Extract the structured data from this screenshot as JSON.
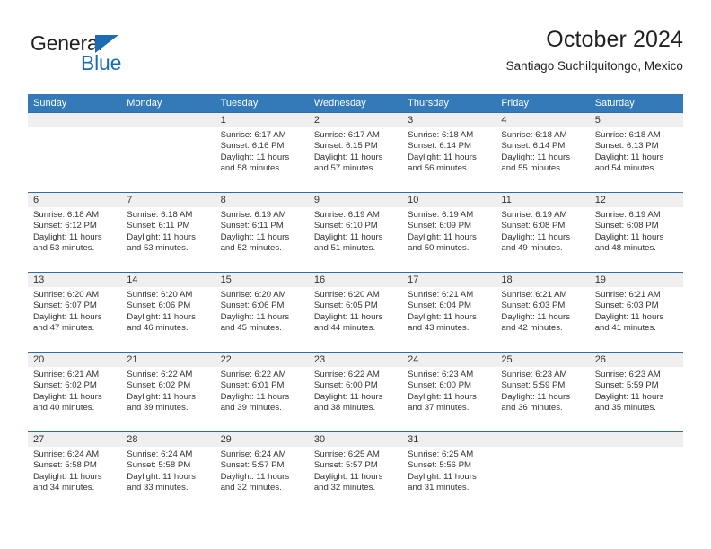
{
  "brand": {
    "name_top": "General",
    "name_bottom": "Blue",
    "accent_color": "#1b6cb5"
  },
  "header": {
    "title": "October 2024",
    "subtitle": "Santiago Suchilquitongo, Mexico"
  },
  "calendar": {
    "header_bg": "#3479b8",
    "number_band_bg": "#efefef",
    "weekday_headers": [
      "Sunday",
      "Monday",
      "Tuesday",
      "Wednesday",
      "Thursday",
      "Friday",
      "Saturday"
    ],
    "weeks": [
      [
        {
          "day": "",
          "sunrise": "",
          "sunset": "",
          "daylight_1": "",
          "daylight_2": ""
        },
        {
          "day": "",
          "sunrise": "",
          "sunset": "",
          "daylight_1": "",
          "daylight_2": ""
        },
        {
          "day": "1",
          "sunrise": "Sunrise: 6:17 AM",
          "sunset": "Sunset: 6:16 PM",
          "daylight_1": "Daylight: 11 hours",
          "daylight_2": "and 58 minutes."
        },
        {
          "day": "2",
          "sunrise": "Sunrise: 6:17 AM",
          "sunset": "Sunset: 6:15 PM",
          "daylight_1": "Daylight: 11 hours",
          "daylight_2": "and 57 minutes."
        },
        {
          "day": "3",
          "sunrise": "Sunrise: 6:18 AM",
          "sunset": "Sunset: 6:14 PM",
          "daylight_1": "Daylight: 11 hours",
          "daylight_2": "and 56 minutes."
        },
        {
          "day": "4",
          "sunrise": "Sunrise: 6:18 AM",
          "sunset": "Sunset: 6:14 PM",
          "daylight_1": "Daylight: 11 hours",
          "daylight_2": "and 55 minutes."
        },
        {
          "day": "5",
          "sunrise": "Sunrise: 6:18 AM",
          "sunset": "Sunset: 6:13 PM",
          "daylight_1": "Daylight: 11 hours",
          "daylight_2": "and 54 minutes."
        }
      ],
      [
        {
          "day": "6",
          "sunrise": "Sunrise: 6:18 AM",
          "sunset": "Sunset: 6:12 PM",
          "daylight_1": "Daylight: 11 hours",
          "daylight_2": "and 53 minutes."
        },
        {
          "day": "7",
          "sunrise": "Sunrise: 6:18 AM",
          "sunset": "Sunset: 6:11 PM",
          "daylight_1": "Daylight: 11 hours",
          "daylight_2": "and 53 minutes."
        },
        {
          "day": "8",
          "sunrise": "Sunrise: 6:19 AM",
          "sunset": "Sunset: 6:11 PM",
          "daylight_1": "Daylight: 11 hours",
          "daylight_2": "and 52 minutes."
        },
        {
          "day": "9",
          "sunrise": "Sunrise: 6:19 AM",
          "sunset": "Sunset: 6:10 PM",
          "daylight_1": "Daylight: 11 hours",
          "daylight_2": "and 51 minutes."
        },
        {
          "day": "10",
          "sunrise": "Sunrise: 6:19 AM",
          "sunset": "Sunset: 6:09 PM",
          "daylight_1": "Daylight: 11 hours",
          "daylight_2": "and 50 minutes."
        },
        {
          "day": "11",
          "sunrise": "Sunrise: 6:19 AM",
          "sunset": "Sunset: 6:08 PM",
          "daylight_1": "Daylight: 11 hours",
          "daylight_2": "and 49 minutes."
        },
        {
          "day": "12",
          "sunrise": "Sunrise: 6:19 AM",
          "sunset": "Sunset: 6:08 PM",
          "daylight_1": "Daylight: 11 hours",
          "daylight_2": "and 48 minutes."
        }
      ],
      [
        {
          "day": "13",
          "sunrise": "Sunrise: 6:20 AM",
          "sunset": "Sunset: 6:07 PM",
          "daylight_1": "Daylight: 11 hours",
          "daylight_2": "and 47 minutes."
        },
        {
          "day": "14",
          "sunrise": "Sunrise: 6:20 AM",
          "sunset": "Sunset: 6:06 PM",
          "daylight_1": "Daylight: 11 hours",
          "daylight_2": "and 46 minutes."
        },
        {
          "day": "15",
          "sunrise": "Sunrise: 6:20 AM",
          "sunset": "Sunset: 6:06 PM",
          "daylight_1": "Daylight: 11 hours",
          "daylight_2": "and 45 minutes."
        },
        {
          "day": "16",
          "sunrise": "Sunrise: 6:20 AM",
          "sunset": "Sunset: 6:05 PM",
          "daylight_1": "Daylight: 11 hours",
          "daylight_2": "and 44 minutes."
        },
        {
          "day": "17",
          "sunrise": "Sunrise: 6:21 AM",
          "sunset": "Sunset: 6:04 PM",
          "daylight_1": "Daylight: 11 hours",
          "daylight_2": "and 43 minutes."
        },
        {
          "day": "18",
          "sunrise": "Sunrise: 6:21 AM",
          "sunset": "Sunset: 6:03 PM",
          "daylight_1": "Daylight: 11 hours",
          "daylight_2": "and 42 minutes."
        },
        {
          "day": "19",
          "sunrise": "Sunrise: 6:21 AM",
          "sunset": "Sunset: 6:03 PM",
          "daylight_1": "Daylight: 11 hours",
          "daylight_2": "and 41 minutes."
        }
      ],
      [
        {
          "day": "20",
          "sunrise": "Sunrise: 6:21 AM",
          "sunset": "Sunset: 6:02 PM",
          "daylight_1": "Daylight: 11 hours",
          "daylight_2": "and 40 minutes."
        },
        {
          "day": "21",
          "sunrise": "Sunrise: 6:22 AM",
          "sunset": "Sunset: 6:02 PM",
          "daylight_1": "Daylight: 11 hours",
          "daylight_2": "and 39 minutes."
        },
        {
          "day": "22",
          "sunrise": "Sunrise: 6:22 AM",
          "sunset": "Sunset: 6:01 PM",
          "daylight_1": "Daylight: 11 hours",
          "daylight_2": "and 39 minutes."
        },
        {
          "day": "23",
          "sunrise": "Sunrise: 6:22 AM",
          "sunset": "Sunset: 6:00 PM",
          "daylight_1": "Daylight: 11 hours",
          "daylight_2": "and 38 minutes."
        },
        {
          "day": "24",
          "sunrise": "Sunrise: 6:23 AM",
          "sunset": "Sunset: 6:00 PM",
          "daylight_1": "Daylight: 11 hours",
          "daylight_2": "and 37 minutes."
        },
        {
          "day": "25",
          "sunrise": "Sunrise: 6:23 AM",
          "sunset": "Sunset: 5:59 PM",
          "daylight_1": "Daylight: 11 hours",
          "daylight_2": "and 36 minutes."
        },
        {
          "day": "26",
          "sunrise": "Sunrise: 6:23 AM",
          "sunset": "Sunset: 5:59 PM",
          "daylight_1": "Daylight: 11 hours",
          "daylight_2": "and 35 minutes."
        }
      ],
      [
        {
          "day": "27",
          "sunrise": "Sunrise: 6:24 AM",
          "sunset": "Sunset: 5:58 PM",
          "daylight_1": "Daylight: 11 hours",
          "daylight_2": "and 34 minutes."
        },
        {
          "day": "28",
          "sunrise": "Sunrise: 6:24 AM",
          "sunset": "Sunset: 5:58 PM",
          "daylight_1": "Daylight: 11 hours",
          "daylight_2": "and 33 minutes."
        },
        {
          "day": "29",
          "sunrise": "Sunrise: 6:24 AM",
          "sunset": "Sunset: 5:57 PM",
          "daylight_1": "Daylight: 11 hours",
          "daylight_2": "and 32 minutes."
        },
        {
          "day": "30",
          "sunrise": "Sunrise: 6:25 AM",
          "sunset": "Sunset: 5:57 PM",
          "daylight_1": "Daylight: 11 hours",
          "daylight_2": "and 32 minutes."
        },
        {
          "day": "31",
          "sunrise": "Sunrise: 6:25 AM",
          "sunset": "Sunset: 5:56 PM",
          "daylight_1": "Daylight: 11 hours",
          "daylight_2": "and 31 minutes."
        },
        {
          "day": "",
          "sunrise": "",
          "sunset": "",
          "daylight_1": "",
          "daylight_2": ""
        },
        {
          "day": "",
          "sunrise": "",
          "sunset": "",
          "daylight_1": "",
          "daylight_2": ""
        }
      ]
    ]
  }
}
